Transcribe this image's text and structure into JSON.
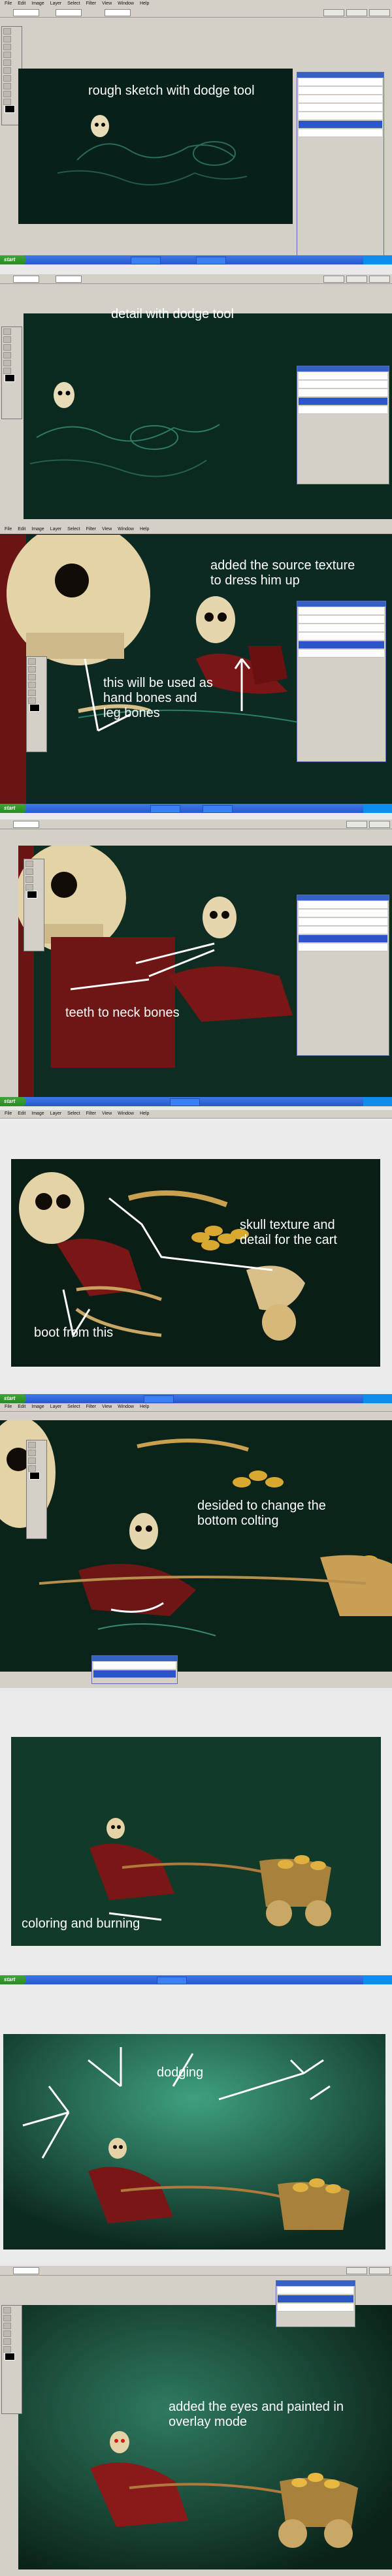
{
  "menu": [
    "File",
    "Edit",
    "Image",
    "Layer",
    "Select",
    "Filter",
    "View",
    "Window",
    "Help"
  ],
  "taskbar": {
    "start_label": "start"
  },
  "panels": [
    {
      "caption_lines": [
        "rough sketch with dodge tool"
      ]
    },
    {
      "caption_lines": [
        "detail with dodge tool"
      ]
    },
    {
      "caption_lines": [
        "added the source texture",
        "to dress him up"
      ],
      "caption2_lines": [
        "this will be used as",
        "hand bones and",
        "leg bones"
      ]
    },
    {
      "caption_lines": [
        "teeth to neck bones"
      ]
    },
    {
      "caption_lines": [
        "skull texture and",
        "detail for the cart"
      ],
      "caption2_lines": [
        "boot from this"
      ]
    },
    {
      "caption_lines": [
        "desided to change the",
        "bottom colting"
      ]
    },
    {
      "caption_lines": [
        "coloring and burning"
      ]
    },
    {
      "caption_lines": [
        "dodging"
      ]
    },
    {
      "caption_lines": [
        "added the eyes and painted in",
        "overlay mode"
      ]
    }
  ],
  "colors": {
    "canvas_dark": "#0c2418",
    "ps_gray": "#d4d0c8",
    "xp_blue": "#2f66d8",
    "robe_red": "#7a1616",
    "gold": "#d8a830",
    "bone": "#e8dcb8"
  }
}
